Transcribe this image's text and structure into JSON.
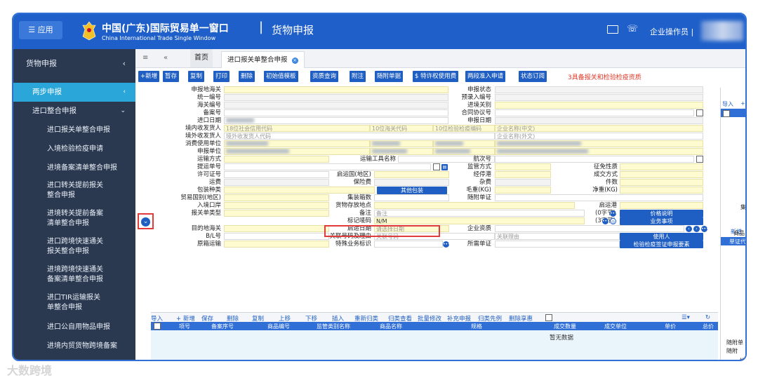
{
  "header": {
    "app_button": "应用",
    "brand_cn": "中国(广东)国际贸易单一窗口",
    "brand_en": "China International Trade Single Window",
    "separator": "|",
    "module": "货物申报",
    "user_label": "企业操作员",
    "user_sep": "|"
  },
  "sidebar": {
    "title": "货物申报",
    "items": [
      {
        "label": "两步申报"
      },
      {
        "label": "进口整合申报"
      }
    ],
    "subitems": [
      "进口报关单整合申报",
      "入境检验检疫申请",
      "进境备案清单整合申报",
      "进口转关提前报关整合申报",
      "进境转关提前备案清单整合申报",
      "进口跨境快速通关报关整合申报",
      "进境跨境快速通关备案清单整合申报",
      "进口TIR运输报关单整合申报",
      "进口公自用物品申报",
      "进境内贸货物跨境备案"
    ]
  },
  "tabs": {
    "home": "首页",
    "current": "进口报关单整合申报"
  },
  "toolbar": {
    "buttons": [
      "+新增",
      "暂存",
      "复制",
      "打印",
      "删除",
      "初始值模板",
      "资质查询",
      "附注",
      "随附单据",
      "$ 特许权使用费",
      "两段准入申请",
      "状态订阅"
    ],
    "warning": "3具备报关和检验检疫资质"
  },
  "form": {
    "labels": {
      "customs_port": "申报地海关",
      "status": "申报状态",
      "unified_no": "统一编号",
      "pre_entry_no": "预录入编号",
      "customs_no": "海关编号",
      "entry_port": "进境关别",
      "record_no": "备案号",
      "contract_no": "合同协议号",
      "import_date": "进口日期",
      "declare_date": "申报日期",
      "domestic_consignee": "境内收发货人",
      "overseas_consignee": "境外收发货人",
      "consumer": "消费使用单位",
      "declarant": "申报单位",
      "transport_mode": "运输方式",
      "transport_name": "运输工具名称",
      "voyage_no": "航次号",
      "bill_no": "提运单号",
      "supervision_mode": "监管方式",
      "levy_nature": "征免性质",
      "license_no": "许可证号",
      "origin_country": "启运国(地区)",
      "transit_port": "经停港",
      "deal_mode": "成交方式",
      "freight": "运费",
      "insurance": "保险费",
      "misc_fee": "杂费",
      "pieces": "件数",
      "package_type": "包装种类",
      "gross_weight": "毛重(KG)",
      "net_weight": "净重(KG)",
      "trade_country": "贸易国别(地区)",
      "container_count": "集装箱数",
      "attached_docs": "随附单证",
      "entry_port2": "入境口岸",
      "goods_location": "货物存放地点",
      "departure_port": "启运港",
      "declaration_type": "报关单类型",
      "remarks": "备注",
      "marks_no": "标记唛码",
      "dest_customs": "目的地海关",
      "departure_date": "启运日期",
      "enterprise_qualification": "企业资质",
      "bl_no": "B/L号",
      "related_no": "关联号码及理由",
      "original_transport": "原箱运输",
      "special_business": "特殊业务标识",
      "required_docs": "所需单证"
    },
    "placeholders": {
      "credit_code": "18位社会信用代码",
      "customs_code": "10位海关代码",
      "ciq_code": "10位检验检疫编码",
      "company_cn": "企业名称(中文)",
      "overseas_consignee": "境外收发货人代码",
      "company_en": "企业名称(外文)",
      "remarks": "备注",
      "marks": "N/M",
      "departure_date": "请选择日期",
      "related_no": "关联号码",
      "related_reason": "关联理由"
    },
    "buttons": {
      "other_package": "其他包装",
      "price_desc": "价格说明",
      "business_items": "业务事项",
      "user": "使用人",
      "ciq_elements": "检验检疫签证申报要素"
    },
    "counters": {
      "remarks_bytes": "(0字节)",
      "marks_bytes": "(3字节)"
    }
  },
  "grid": {
    "toolbar": [
      "导入",
      "+ 新增",
      "保存",
      "删除",
      "复制",
      "上移",
      "下移",
      "插入",
      "重新归类",
      "归类查看",
      "批量修改",
      "补充申报",
      "归类先例",
      "删除享惠"
    ],
    "columns": [
      "项号",
      "备案序号",
      "商品编号",
      "监管类别名称",
      "商品名称",
      "规格",
      "成交数量",
      "成交单位",
      "单价",
      "总价"
    ],
    "empty_text": "暂无数据"
  },
  "right_panel": {
    "labels": [
      "导入",
      "+",
      "新增",
      "单证代码",
      "集",
      "商品",
      "随附单",
      "随附",
      "关"
    ]
  },
  "watermark": "大数跨境",
  "colors": {
    "header_blue": "#1e5fc9",
    "sidebar_dark": "#2b3950",
    "active_cyan": "#2aa7d8",
    "field_yellow": "#fffbd0",
    "highlight_red": "#e23b3b"
  }
}
